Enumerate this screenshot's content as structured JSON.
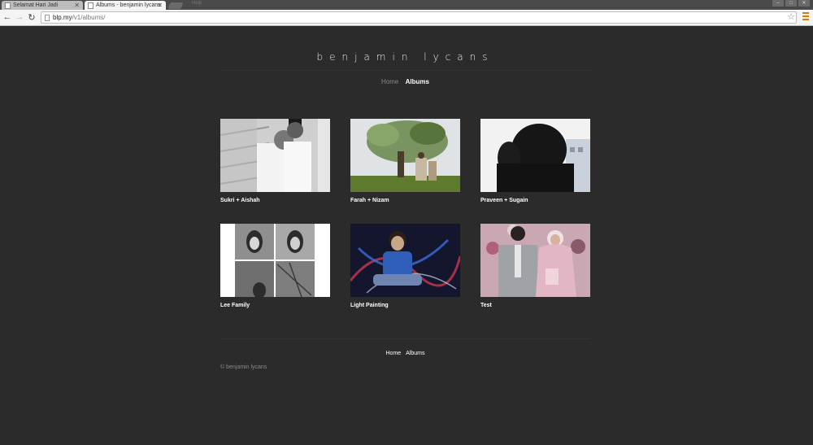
{
  "browser": {
    "tabs": [
      {
        "label": "Selamat Hari Jadi",
        "active": false
      },
      {
        "label": "Albums - benjamin lycans",
        "active": true
      }
    ],
    "ghost_tab": "Help",
    "url_domain": "blp.my",
    "url_path": "/v1/albums/"
  },
  "site": {
    "title": "benjamin lycans",
    "nav": {
      "home": "Home",
      "albums": "Albums"
    }
  },
  "albums": [
    {
      "caption": "Sukri + Aishah"
    },
    {
      "caption": "Farah + Nizam"
    },
    {
      "caption": "Praveen + Sugain"
    },
    {
      "caption": "Lee Family"
    },
    {
      "caption": "Light Painting"
    },
    {
      "caption": "Test"
    }
  ],
  "footer": {
    "nav": {
      "home": "Home",
      "albums": "Albums"
    },
    "copyright": "© benjamin lycans"
  },
  "colors": {
    "background": "#2b2b2b",
    "accent": "#e07b00"
  }
}
